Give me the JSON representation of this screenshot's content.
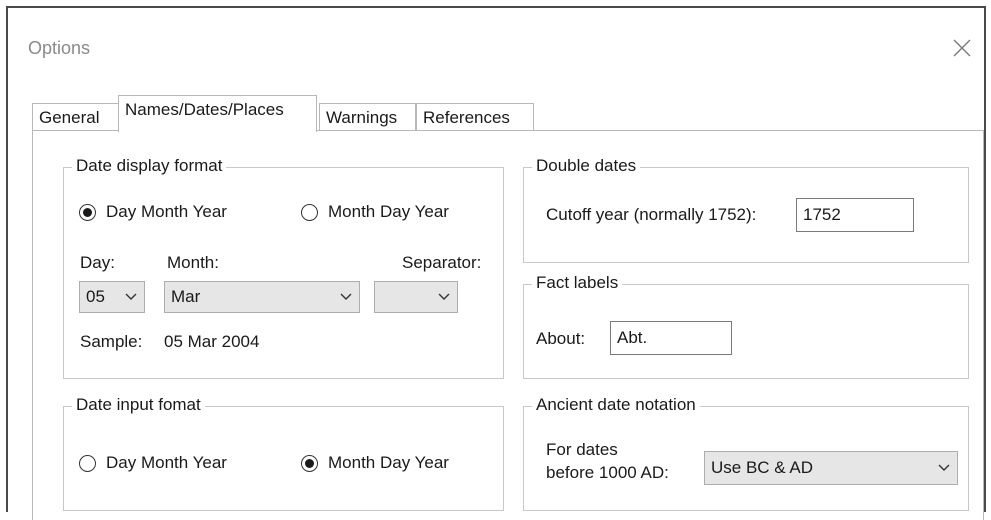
{
  "dialog": {
    "title": "Options"
  },
  "tabs": [
    {
      "label": "General"
    },
    {
      "label": "Names/Dates/Places"
    },
    {
      "label": "Warnings"
    },
    {
      "label": "References"
    }
  ],
  "date_display": {
    "legend": "Date display format",
    "option_dmy": "Day Month Year",
    "option_mdy": "Month Day Year",
    "selected": "Day Month Year",
    "day_label": "Day:",
    "day_value": "05",
    "month_label": "Month:",
    "month_value": "Mar",
    "separator_label": "Separator:",
    "separator_value": "",
    "sample_label": "Sample:",
    "sample_value": "05 Mar 2004"
  },
  "date_input": {
    "legend": "Date input fomat",
    "option_dmy": "Day Month Year",
    "option_mdy": "Month Day Year",
    "selected": "Month Day Year"
  },
  "double_dates": {
    "legend": "Double dates",
    "cutoff_label": "Cutoff year (normally 1752):",
    "cutoff_value": "1752"
  },
  "fact_labels": {
    "legend": "Fact labels",
    "about_label": "About:",
    "about_value": "Abt."
  },
  "ancient": {
    "legend": "Ancient date notation",
    "label_line1": "For dates",
    "label_line2": "before 1000 AD:",
    "value": "Use BC & AD"
  },
  "icons": {
    "close": "close-icon",
    "dropdown": "chevron-down-icon"
  }
}
